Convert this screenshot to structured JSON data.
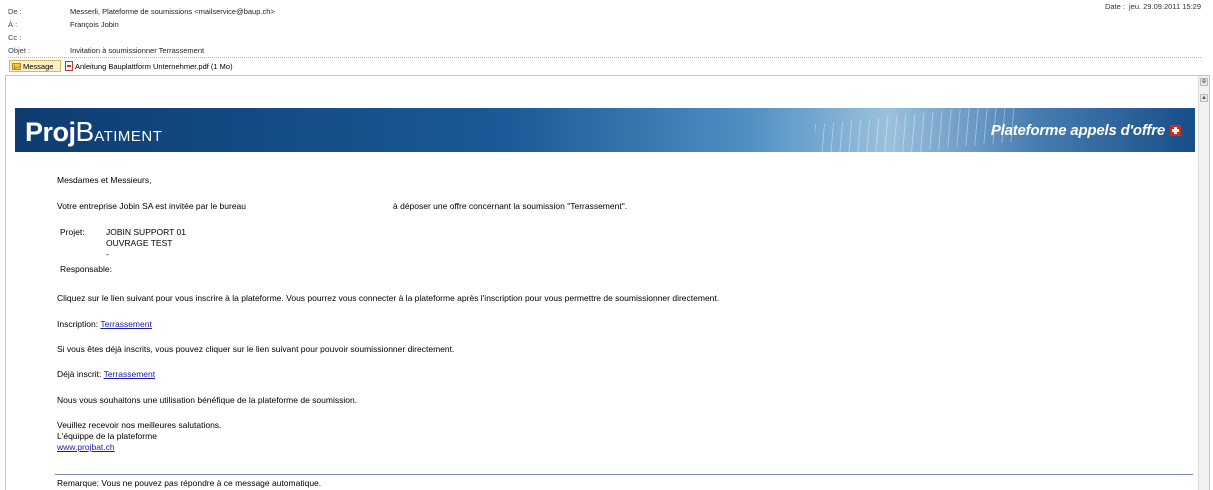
{
  "header": {
    "fields": [
      {
        "label": "De :",
        "value": "Messerli, Plateforme de soumissions <mailservice@baup.ch>"
      },
      {
        "label": "À :",
        "value": "François Jobin"
      },
      {
        "label": "Cc :",
        "value": ""
      },
      {
        "label": "Objet :",
        "value": "Invitation à soumissionner Terrassement"
      }
    ],
    "date_label": "Date :",
    "date_value": "jeu. 29.09.2011 15:29"
  },
  "attachments": {
    "message_tab": "Message",
    "file": "Anleitung Bauplattform Unternehmer.pdf (1 Mo)"
  },
  "banner": {
    "logo_part1": "Proj",
    "logo_part2": "B",
    "logo_part3": "ATIMENT",
    "tagline": "Plateforme appels d'offre"
  },
  "body": {
    "greeting": "Mesdames et Messieurs,",
    "invite_part1": "Votre entreprise Jobin SA est invitée par le bureau",
    "invite_part2": "à déposer une offre concernant la soumission \"Terrassement\".",
    "project_label": "Projet:",
    "project_line1": "JOBIN SUPPORT 01",
    "project_line2": "OUVRAGE TEST",
    "project_line3": "-",
    "responsible_label": "Responsable:",
    "instructions": "Cliquez sur le lien suivant pour vous inscrire à la plateforme. Vous pourrez vous connecter à la plateforme après l'inscription pour vous permettre de soumissionner directement.",
    "inscription_label": "Inscription:",
    "inscription_link": "Terrassement",
    "already_text": "Si vous êtes déjà inscrits, vous pouvez cliquer sur le lien suivant pour pouvoir soumissionner directement.",
    "already_label": "Déjà inscrit:",
    "already_link": "Terrassement",
    "wish": "Nous vous souhaitons une utilisation bénéfique de la plateforme de soumission.",
    "closing1": "Veuillez recevoir nos meilleures salutations.",
    "closing2": "L'équippe de la plateforme",
    "website": "www.projbat.ch",
    "remark": "Remarque: Vous ne pouvez pas répondre à ce message automatique."
  }
}
